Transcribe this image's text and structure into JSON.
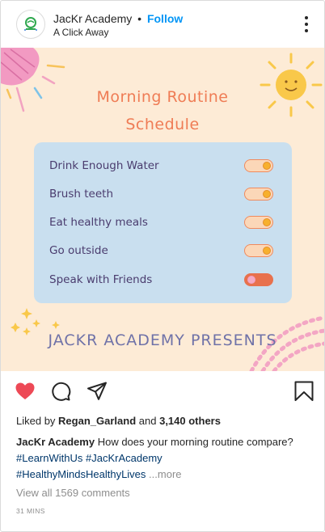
{
  "header": {
    "account_name": "JacKr Academy",
    "separator": "•",
    "follow_label": "Follow",
    "location": "A Click Away"
  },
  "image": {
    "title_line1": "Morning Routine",
    "title_line2": "Schedule",
    "routine_items": [
      {
        "label": "Drink Enough Water",
        "toggle": "on"
      },
      {
        "label": "Brush teeth",
        "toggle": "on"
      },
      {
        "label": "Eat healthy meals",
        "toggle": "on"
      },
      {
        "label": "Go outside",
        "toggle": "on"
      },
      {
        "label": "Speak with Friends",
        "toggle": "off"
      }
    ],
    "footer_text": "JACKR ACADEMY PRESENTS"
  },
  "actions": {
    "liked": true,
    "like_color": "#ed4956",
    "icons": [
      "heart-icon",
      "comment-icon",
      "share-icon",
      "bookmark-icon"
    ]
  },
  "likes": {
    "prefix": "Liked by",
    "user": "Regan_Garland",
    "conjunction": "and",
    "others": "3,140 others"
  },
  "caption": {
    "author": "JacKr Academy",
    "text": "How does your morning routine compare?",
    "hashtags": [
      "#LearnWithUs",
      "#JacKrAcademy",
      "#HealthyMindsHealthyLives"
    ],
    "more_label": "...more"
  },
  "comments": {
    "view_all_label": "View all 1569 comments"
  },
  "timestamp": "31 MINS",
  "colors": {
    "accent": "#0095f6",
    "background_image": "#fdebd6",
    "card": "#c9dfef",
    "title": "#ef7c55",
    "presents": "#6f72a8"
  }
}
